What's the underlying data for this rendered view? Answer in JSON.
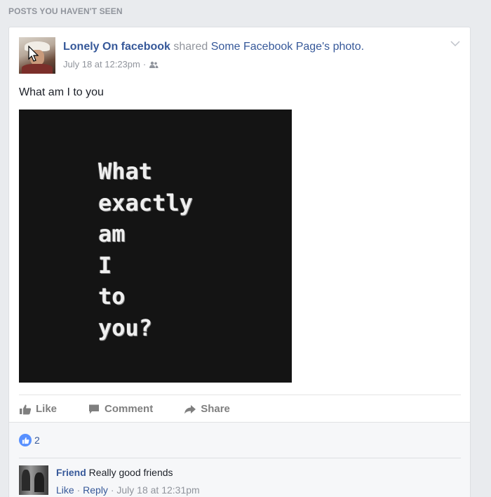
{
  "feed": {
    "section_title": "POSTS YOU HAVEN'T SEEN"
  },
  "post": {
    "author": "Lonely On facebook",
    "shared_text": "shared",
    "shared_object": "Some Facebook Page's photo.",
    "timestamp": "July 18 at 12:23pm",
    "separator": "·",
    "audience_icon": "friends-icon",
    "text": "What am I to you",
    "photo_lines": [
      "What",
      "exactly",
      "am",
      "I",
      "to",
      "you?"
    ]
  },
  "actions": {
    "like_label": "Like",
    "comment_label": "Comment",
    "share_label": "Share"
  },
  "reactions": {
    "count": "2"
  },
  "comment": {
    "author": "Friend",
    "text": "Really good friends",
    "like_label": "Like",
    "reply_label": "Reply",
    "separator": "·",
    "timestamp": "July 18 at 12:31pm"
  },
  "colors": {
    "link_blue": "#365899",
    "meta_gray": "#90949c",
    "background": "#e9ebee",
    "like_blue": "#5890ff"
  }
}
